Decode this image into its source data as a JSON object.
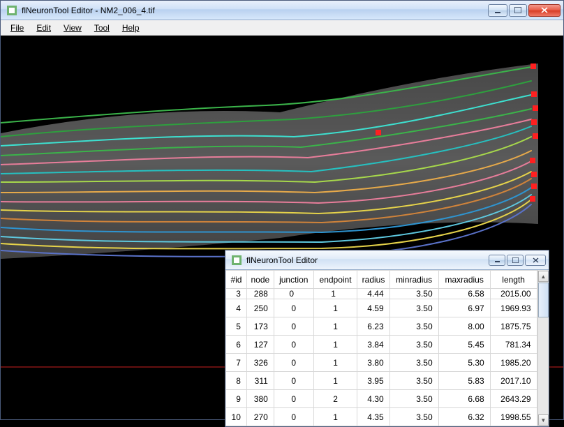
{
  "mainWindow": {
    "title": "flNeuronTool Editor - NM2_006_4.tif"
  },
  "menubar": {
    "items": [
      {
        "label": "File"
      },
      {
        "label": "Edit"
      },
      {
        "label": "View"
      },
      {
        "label": "Tool"
      },
      {
        "label": "Help"
      }
    ]
  },
  "childWindow": {
    "title": "flNeuronTool Editor"
  },
  "table": {
    "headers": [
      "#id",
      "node",
      "junction",
      "endpoint",
      "radius",
      "minradius",
      "maxradius",
      "length"
    ],
    "rows": [
      {
        "id": "3",
        "node": "288",
        "junction": "0",
        "endpoint": "1",
        "radius": "4.44",
        "minradius": "3.50",
        "maxradius": "6.58",
        "length": "2015.00"
      },
      {
        "id": "4",
        "node": "250",
        "junction": "0",
        "endpoint": "1",
        "radius": "4.59",
        "minradius": "3.50",
        "maxradius": "6.97",
        "length": "1969.93"
      },
      {
        "id": "5",
        "node": "173",
        "junction": "0",
        "endpoint": "1",
        "radius": "6.23",
        "minradius": "3.50",
        "maxradius": "8.00",
        "length": "1875.75"
      },
      {
        "id": "6",
        "node": "127",
        "junction": "0",
        "endpoint": "1",
        "radius": "3.84",
        "minradius": "3.50",
        "maxradius": "5.45",
        "length": "781.34"
      },
      {
        "id": "7",
        "node": "326",
        "junction": "0",
        "endpoint": "1",
        "radius": "3.80",
        "minradius": "3.50",
        "maxradius": "5.30",
        "length": "1985.20"
      },
      {
        "id": "8",
        "node": "311",
        "junction": "0",
        "endpoint": "1",
        "radius": "3.95",
        "minradius": "3.50",
        "maxradius": "5.83",
        "length": "2017.10"
      },
      {
        "id": "9",
        "node": "380",
        "junction": "0",
        "endpoint": "2",
        "radius": "4.30",
        "minradius": "3.50",
        "maxradius": "6.68",
        "length": "2643.29"
      },
      {
        "id": "10",
        "node": "270",
        "junction": "0",
        "endpoint": "1",
        "radius": "4.35",
        "minradius": "3.50",
        "maxradius": "6.32",
        "length": "1998.55"
      }
    ]
  }
}
